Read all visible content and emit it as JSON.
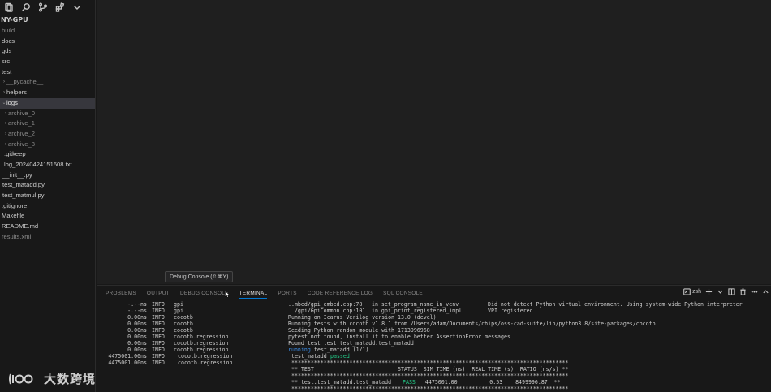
{
  "sidebar": {
    "root_label": "NY-GPU",
    "toolbar_icons": [
      "files-icon",
      "search-icon",
      "source-control-icon",
      "extensions-icon",
      "chevron-down-icon"
    ],
    "items": [
      {
        "label": "build",
        "color": "gray",
        "indent": 1,
        "chevron": ""
      },
      {
        "label": "docs",
        "color": "light",
        "indent": 1,
        "chevron": ""
      },
      {
        "label": "gds",
        "color": "light",
        "indent": 1,
        "chevron": ""
      },
      {
        "label": "src",
        "color": "light",
        "indent": 1,
        "chevron": ""
      },
      {
        "label": "test",
        "color": "light",
        "indent": 1,
        "chevron": ""
      },
      {
        "label": "__pycache__",
        "color": "gray",
        "indent": 2,
        "chevron": ">"
      },
      {
        "label": "helpers",
        "color": "light",
        "indent": 2,
        "chevron": ">"
      },
      {
        "label": "logs",
        "color": "white",
        "indent": 2,
        "chevron": "v",
        "selected": true
      },
      {
        "label": "archive_0",
        "color": "gray",
        "indent": 3,
        "chevron": ">"
      },
      {
        "label": "archive_1",
        "color": "gray",
        "indent": 3,
        "chevron": ">"
      },
      {
        "label": "archive_2",
        "color": "gray",
        "indent": 3,
        "chevron": ">"
      },
      {
        "label": "archive_3",
        "color": "gray",
        "indent": 3,
        "chevron": ">"
      },
      {
        "label": ".gitkeep",
        "color": "light",
        "indent": 3,
        "chevron": ""
      },
      {
        "label": "log_20240424151608.txt",
        "color": "light",
        "indent": 3,
        "chevron": ""
      },
      {
        "label": "__init__.py",
        "color": "light",
        "indent": 2,
        "chevron": ""
      },
      {
        "label": "test_matadd.py",
        "color": "light",
        "indent": 2,
        "chevron": ""
      },
      {
        "label": "test_matmul.py",
        "color": "light",
        "indent": 2,
        "chevron": ""
      },
      {
        "label": ".gitignore",
        "color": "light",
        "indent": 1,
        "chevron": ""
      },
      {
        "label": "Makefile",
        "color": "light",
        "indent": 1,
        "chevron": ""
      },
      {
        "label": "README.md",
        "color": "light",
        "indent": 1,
        "chevron": ""
      },
      {
        "label": "results.xml",
        "color": "gray",
        "indent": 1,
        "chevron": ""
      }
    ]
  },
  "tooltip": "Debug Console (⇧⌘Y)",
  "panel": {
    "tabs": [
      {
        "label": "PROBLEMS",
        "active": false
      },
      {
        "label": "OUTPUT",
        "active": false
      },
      {
        "label": "DEBUG CONSOLE",
        "active": false
      },
      {
        "label": "TERMINAL",
        "active": true
      },
      {
        "label": "PORTS",
        "active": false
      },
      {
        "label": "CODE REFERENCE LOG",
        "active": false
      },
      {
        "label": "SQL CONSOLE",
        "active": false
      }
    ],
    "shell_label": "zsh",
    "actions": [
      "terminal-icon",
      "plus-icon",
      "chevron-down-icon",
      "split-icon",
      "trash-icon",
      "more-icon",
      "chevron-up-icon"
    ]
  },
  "terminal": {
    "lines": [
      {
        "time": "-.--ns",
        "level": "INFO",
        "src": "gpi",
        "file": "..mbed/gpi_embed.cpp:78",
        "func": "in set_program_name_in_venv",
        "msg": "Did not detect Python virtual environment. Using system-wide Python interpreter"
      },
      {
        "time": "-.--ns",
        "level": "INFO",
        "src": "gpi",
        "file": "../gpi/GpiCommon.cpp:101",
        "func": "in gpi_print_registered_impl",
        "msg": "VPI registered"
      },
      {
        "time": "0.00ns",
        "level": "INFO",
        "src": "cocotb",
        "file": "Running on Icarus Verilog version 13.0 (devel)",
        "func": "",
        "msg": ""
      },
      {
        "time": "0.00ns",
        "level": "INFO",
        "src": "cocotb",
        "file": "Running tests with cocotb v1.8.1 from /Users/adam/Documents/chips/oss-cad-suite/lib/python3.8/site-packages/cocotb",
        "func": "",
        "msg": ""
      },
      {
        "time": "0.00ns",
        "level": "INFO",
        "src": "cocotb",
        "file": "Seeding Python random module with 1713996968",
        "func": "",
        "msg": ""
      },
      {
        "time": "0.00ns",
        "level": "INFO",
        "src": "cocotb.regression",
        "file": "pytest not found, install it to enable better AssertionError messages",
        "func": "",
        "msg": ""
      },
      {
        "time": "0.00ns",
        "level": "INFO",
        "src": "cocotb.regression",
        "file": "Found test test.test_matadd.test_matadd",
        "func": "",
        "msg": ""
      },
      {
        "time": "0.00ns",
        "level": "INFO",
        "src": "cocotb.regression",
        "file": "running",
        "func": "test_matadd (1/1)",
        "msg": ""
      },
      {
        "time": "4475001.00ns",
        "level": "INFO",
        "src": "cocotb.regression",
        "file": "test_matadd",
        "func": "passed",
        "msg": ""
      },
      {
        "time": "4475001.00ns",
        "level": "INFO",
        "src": "cocotb.regression",
        "file": "",
        "func": "",
        "msg": ""
      }
    ],
    "report": {
      "stars": "**************************************************************************************",
      "header": "** TEST                          STATUS  SIM TIME (ns)  REAL TIME (s)  RATIO (ns/s) **",
      "row_name": "** test.test_matadd.test_matadd",
      "row_status": "PASS",
      "row_rest": "   4475001.00          0.53    8499996.87  **"
    }
  },
  "watermark": {
    "text": "大数跨境"
  }
}
